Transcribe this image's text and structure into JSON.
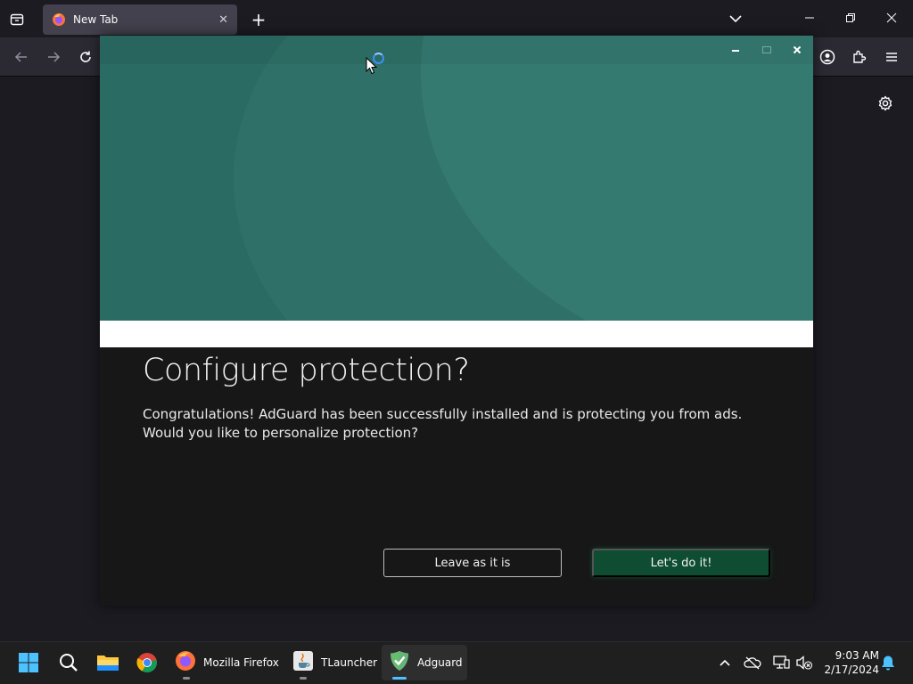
{
  "browser": {
    "tab_title": "New Tab"
  },
  "adguard": {
    "heading": "Configure protection?",
    "description": "Congratulations! AdGuard has been successfully installed and is protecting you from ads. Would you like to personalize protection?",
    "leave_button": "Leave as it is",
    "do_button": "Let's do it!",
    "accent_color": "#0f4d33",
    "hero_color": "#2a6b64"
  },
  "taskbar": {
    "items": [
      {
        "label": "Mozilla Firefox"
      },
      {
        "label": "TLauncher"
      },
      {
        "label": "Adguard"
      }
    ],
    "time": "9:03 AM",
    "date": "2/17/2024"
  }
}
